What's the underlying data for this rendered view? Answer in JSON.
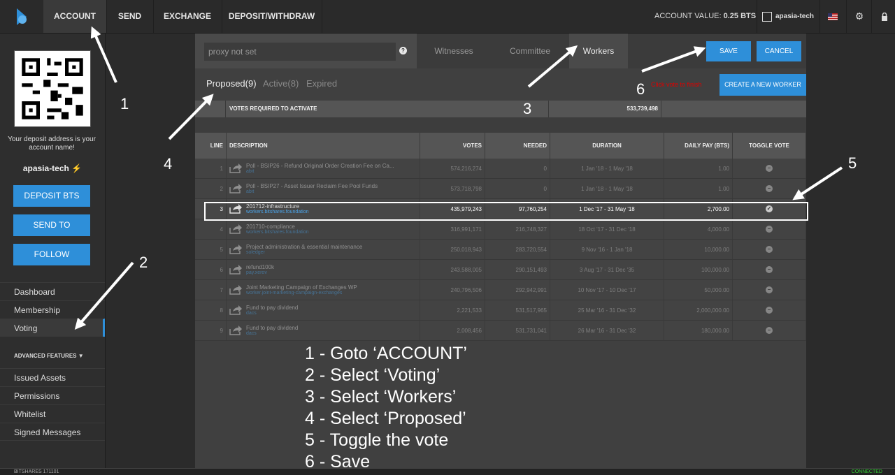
{
  "topnav": {
    "tabs": [
      "ACCOUNT",
      "SEND",
      "EXCHANGE",
      "DEPOSIT/WITHDRAW"
    ],
    "account_value_label": "ACCOUNT VALUE:",
    "account_value": "0.25 BTS",
    "user": "apasia-tech"
  },
  "sidebar": {
    "deposit_text": "Your deposit address is your account name!",
    "account_name": "apasia-tech",
    "buttons": [
      "DEPOSIT BTS",
      "SEND TO",
      "FOLLOW"
    ],
    "menu": [
      "Dashboard",
      "Membership",
      "Voting"
    ],
    "advanced_label": "ADVANCED FEATURES ▼",
    "advanced_menu": [
      "Issued Assets",
      "Permissions",
      "Whitelist",
      "Signed Messages"
    ],
    "version": "BITSHARES 171101",
    "status": "CONNECTED"
  },
  "voting": {
    "proxy_placeholder": "proxy not set",
    "tabs": [
      "Witnesses",
      "Committee",
      "Workers"
    ],
    "save": "SAVE",
    "cancel": "CANCEL",
    "subtabs": [
      "Proposed(9)",
      "Active(8)",
      "Expired"
    ],
    "click_note": "Click vote to finish",
    "create_worker": "CREATE A NEW WORKER",
    "votes_required_label": "VOTES REQUIRED TO ACTIVATE",
    "votes_required_value": "533,739,498",
    "columns": [
      "LINE",
      "DESCRIPTION",
      "VOTES",
      "NEEDED",
      "DURATION",
      "DAILY PAY (BTS)",
      "TOGGLE VOTE"
    ],
    "rows": [
      {
        "line": "1",
        "title": "Poll - BSIP26 - Refund Original Order Creation Fee on Ca...",
        "sub": "abit",
        "votes": "574,216,274",
        "needed": "0",
        "duration": "1 Jan '18 - 1 May '18",
        "pay": "1.00",
        "voted": false
      },
      {
        "line": "2",
        "title": "Poll - BSIP27 - Asset Issuer Reclaim Fee Pool Funds",
        "sub": "abit",
        "votes": "573,718,798",
        "needed": "0",
        "duration": "1 Jan '18 - 1 May '18",
        "pay": "1.00",
        "voted": false
      },
      {
        "line": "3",
        "title": "201712-infrastructure",
        "sub": "workers.bitshares.foundation",
        "votes": "435,979,243",
        "needed": "97,760,254",
        "duration": "1 Dec '17 - 31 May '18",
        "pay": "2,700.00",
        "voted": true
      },
      {
        "line": "4",
        "title": "201710-compliance",
        "sub": "workers.bitshares.foundation",
        "votes": "316,991,171",
        "needed": "216,748,327",
        "duration": "18 Oct '17 - 31 Dec '18",
        "pay": "4,000.00",
        "voted": false
      },
      {
        "line": "5",
        "title": "Project administration & essential maintenance",
        "sub": "soledger",
        "votes": "250,018,943",
        "needed": "283,720,554",
        "duration": "9 Nov '16 - 1 Jan '18",
        "pay": "10,000.00",
        "voted": false
      },
      {
        "line": "6",
        "title": "refund100k",
        "sub": "pay.xerov",
        "votes": "243,588,005",
        "needed": "290,151,493",
        "duration": "3 Aug '17 - 31 Dec '35",
        "pay": "100,000.00",
        "voted": false
      },
      {
        "line": "7",
        "title": "Joint Marketing Campaign of Exchanges WP",
        "sub": "worker.joint-marketing-campaign-exchanges",
        "votes": "240,796,506",
        "needed": "292,942,991",
        "duration": "10 Nov '17 - 10 Dec '17",
        "pay": "50,000.00",
        "voted": false
      },
      {
        "line": "8",
        "title": "Fund to pay dividend",
        "sub": "dacs",
        "votes": "2,221,533",
        "needed": "531,517,965",
        "duration": "25 Mar '16 - 31 Dec '32",
        "pay": "2,000,000.00",
        "voted": false
      },
      {
        "line": "9",
        "title": "Fund to pay dividend",
        "sub": "dacs",
        "votes": "2,008,456",
        "needed": "531,731,041",
        "duration": "26 Mar '16 - 31 Dec '32",
        "pay": "180,000.00",
        "voted": false
      }
    ]
  },
  "annotations": {
    "numbers": [
      "1",
      "2",
      "3",
      "4",
      "5",
      "6"
    ],
    "steps": [
      "1 - Goto ‘ACCOUNT’",
      "2 - Select ‘Voting’",
      "3 - Select ‘Workers’",
      "4 - Select ‘Proposed’",
      "5 - Toggle the vote",
      "6 - Save"
    ]
  }
}
